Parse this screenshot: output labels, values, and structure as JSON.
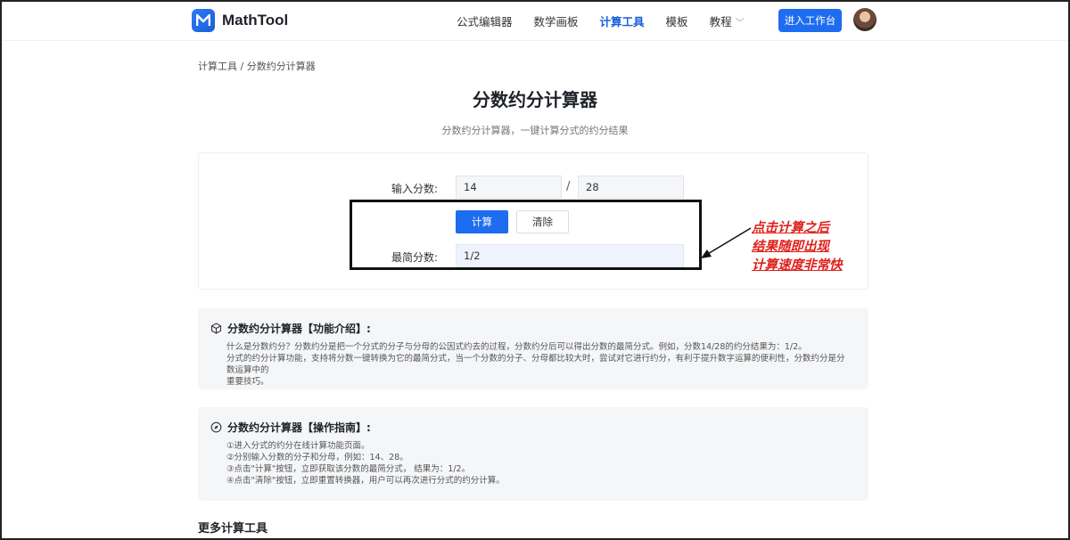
{
  "header": {
    "brand": "MathTool",
    "nav": [
      {
        "label": "公式编辑器",
        "active": false
      },
      {
        "label": "数学画板",
        "active": false
      },
      {
        "label": "计算工具",
        "active": true
      },
      {
        "label": "模板",
        "active": false
      },
      {
        "label": "教程",
        "active": false
      }
    ],
    "enter_button": "进入工作台"
  },
  "breadcrumb": "计算工具 / 分数约分计算器",
  "page": {
    "title": "分数约分计算器",
    "subtitle": "分数约分计算器，一键计算分式的约分结果"
  },
  "calculator": {
    "input_label": "输入分数:",
    "numerator": "14",
    "slash": "/",
    "denominator": "28",
    "calc_button": "计算",
    "clear_button": "清除",
    "result_label": "最简分数:",
    "result": "1/2"
  },
  "annotation": {
    "lines": [
      "点击计算之后",
      "结果随即出现",
      "计算速度非常快"
    ],
    "color": "#e0201a"
  },
  "intro": {
    "title": "分数约分计算器【功能介绍】:",
    "lines": [
      "什么是分数约分？分数约分是把一个分式的分子与分母的公因式约去的过程，分数约分后可以得出分数的最简分式。例如，分数14/28的约分结果为：1/2。",
      "分式的约分计算功能，支持将分数一键转换为它的最简分式，当一个分数的分子、分母都比较大时，尝试对它进行约分，有利于提升数字运算的便利性，分数约分是分数运算中的",
      "重要技巧。"
    ]
  },
  "guide": {
    "title": "分数约分计算器【操作指南】:",
    "lines": [
      "①进入分式的约分在线计算功能页面。",
      "②分别输入分数的分子和分母，例如：14、28。",
      "③点击\"计算\"按钮，立即获取该分数的最简分式， 结果为：1/2。",
      "④点击\"清除\"按钮，立即重置转换器，用户可以再次进行分式的约分计算。"
    ]
  },
  "more_tools_title": "更多计算工具",
  "colors": {
    "accent": "#1e6cf0",
    "annotation": "#e0201a"
  }
}
